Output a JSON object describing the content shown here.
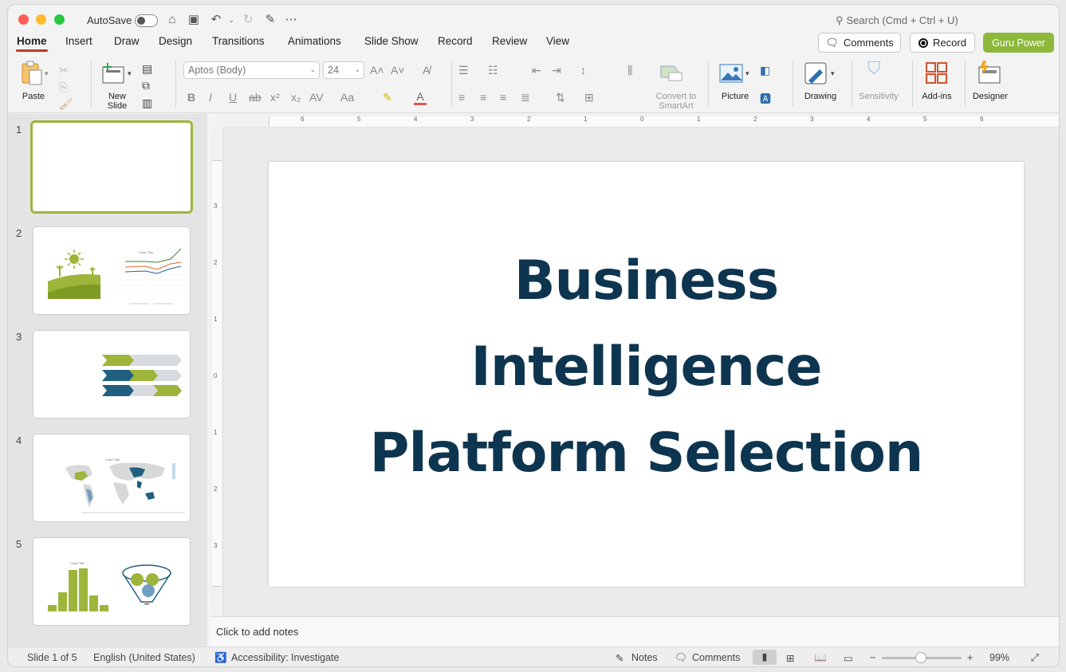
{
  "titlebar": {
    "autosave_label": "AutoSave",
    "search_placeholder": "Search (Cmd + Ctrl + U)"
  },
  "tabs": [
    "Home",
    "Insert",
    "Draw",
    "Design",
    "Transitions",
    "Animations",
    "Slide Show",
    "Record",
    "Review",
    "View"
  ],
  "active_tab": "Home",
  "top_buttons": {
    "comments": "Comments",
    "record": "Record",
    "guru": "Guru Power"
  },
  "ribbon": {
    "paste": "Paste",
    "new_slide_1": "New",
    "new_slide_2": "Slide",
    "font_name": "Aptos (Body)",
    "font_size": "24",
    "convert_1": "Convert to",
    "convert_2": "SmartArt",
    "picture": "Picture",
    "drawing": "Drawing",
    "sensitivity": "Sensitivity",
    "addins": "Add-ins",
    "designer": "Designer"
  },
  "slides": [
    {
      "num": "1"
    },
    {
      "num": "2",
      "chart_title": "Chart Title"
    },
    {
      "num": "3"
    },
    {
      "num": "4",
      "chart_title": "Chart Title"
    },
    {
      "num": "5",
      "chart_title": "Chart Title"
    }
  ],
  "slide": {
    "line1": "Business",
    "line2": "Intelligence",
    "line3": "Platform Selection"
  },
  "ruler_h_labels": [
    "6",
    "5",
    "4",
    "3",
    "2",
    "1",
    "0",
    "1",
    "2",
    "3",
    "4",
    "5",
    "6"
  ],
  "ruler_v_labels": [
    "3",
    "2",
    "1",
    "0",
    "1",
    "2",
    "3"
  ],
  "notes_placeholder": "Click to add notes",
  "status": {
    "slide_of": "Slide 1 of 5",
    "language": "English (United States)",
    "accessibility": "Accessibility: Investigate",
    "notes": "Notes",
    "comments": "Comments",
    "zoom": "99%"
  },
  "colors": {
    "accent_red": "#c0392b",
    "guru_green": "#8db83b",
    "title_navy": "#0e3550",
    "lime": "#9cb53a",
    "teal": "#1f5f80"
  }
}
